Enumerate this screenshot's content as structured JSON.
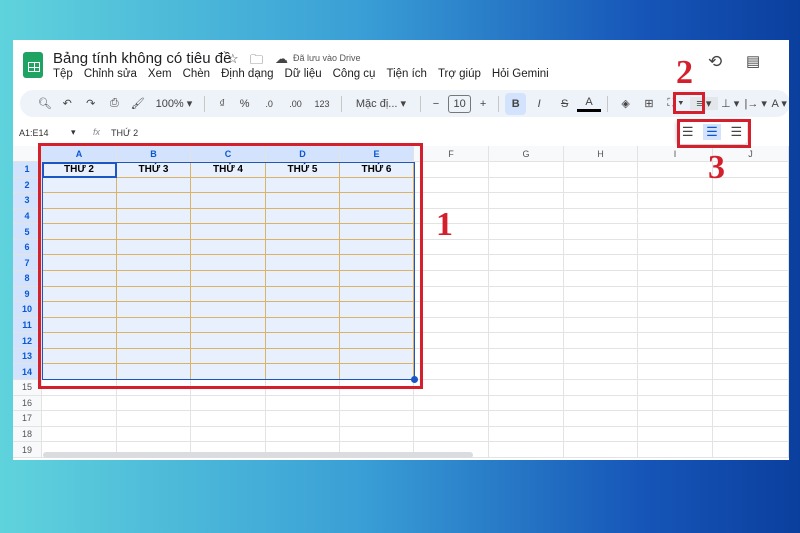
{
  "doc": {
    "title": "Bảng tính không có tiêu đề",
    "saved": "Đã lưu vào Drive"
  },
  "menu": [
    "Tệp",
    "Chỉnh sửa",
    "Xem",
    "Chèn",
    "Định dạng",
    "Dữ liệu",
    "Công cụ",
    "Tiện ích",
    "Trợ giúp",
    "Hỏi Gemini"
  ],
  "toolbar": {
    "zoom": "100%",
    "currency": "₫",
    "percent": "%",
    "dec_less": ".0",
    "dec_more": ".00",
    "number_format": "123",
    "font": "Mặc đị...",
    "font_size": "10",
    "bold": "B",
    "italic": "I",
    "text_color": "A"
  },
  "formula": {
    "range": "A1:E14",
    "fx": "fx",
    "value": "THỨ 2"
  },
  "grid": {
    "columns": [
      "A",
      "B",
      "C",
      "D",
      "E",
      "F",
      "G",
      "H",
      "I",
      "J"
    ],
    "rows": [
      "1",
      "2",
      "3",
      "4",
      "5",
      "6",
      "7",
      "8",
      "9",
      "10",
      "11",
      "12",
      "13",
      "14",
      "15",
      "16",
      "17",
      "18",
      "19"
    ],
    "header_row": [
      "THỨ 2",
      "THỨ 3",
      "THỨ 4",
      "THỨ 5",
      "THỨ 6"
    ]
  },
  "annotations": [
    "1",
    "2",
    "3"
  ]
}
